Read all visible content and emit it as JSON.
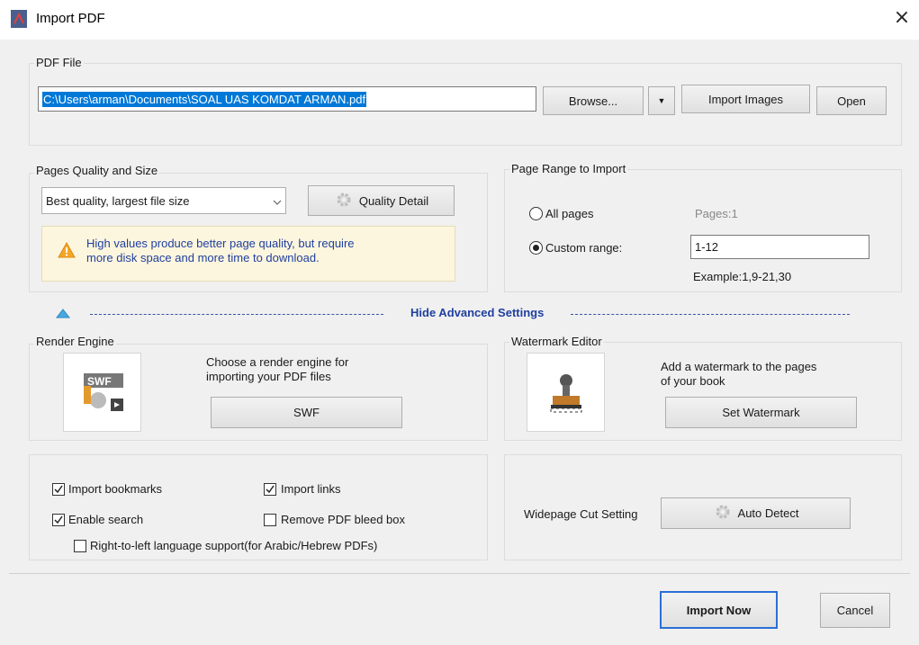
{
  "window": {
    "title": "Import PDF",
    "close_glyph": "×"
  },
  "pdf_file": {
    "group_label": "PDF File",
    "path_value": "C:\\Users\\arman\\Documents\\SOAL UAS KOMDAT ARMAN.pdf",
    "browse_label": "Browse...",
    "dropdown_glyph": "▼",
    "import_images_label": "Import Images",
    "open_label": "Open"
  },
  "quality": {
    "group_label": "Pages Quality and Size",
    "selected": "Best quality, largest file size",
    "quality_detail_label": "Quality Detail",
    "warning_text_line1": "High values produce better page quality, but require",
    "warning_text_line2": "more disk space and more time to download."
  },
  "page_range": {
    "group_label": "Page Range to Import",
    "all_pages_label": "All pages",
    "pages_info": "Pages:1",
    "custom_range_label": "Custom range:",
    "custom_range_value": "1-12",
    "example": "Example:1,9-21,30",
    "selected": "custom"
  },
  "advanced": {
    "toggle_label": "Hide Advanced Settings"
  },
  "render_engine": {
    "group_label": "Render Engine",
    "description_line1": "Choose a render engine for",
    "description_line2": "importing your PDF files",
    "button_label": "SWF",
    "icon_text": "SWF"
  },
  "watermark": {
    "group_label": "Watermark Editor",
    "description_line1": "Add a watermark to the pages",
    "description_line2": "of your book",
    "button_label": "Set Watermark"
  },
  "options": {
    "import_bookmarks": {
      "label": "Import bookmarks",
      "checked": true
    },
    "import_links": {
      "label": "Import links",
      "checked": true
    },
    "enable_search": {
      "label": "Enable search",
      "checked": true
    },
    "remove_bleed": {
      "label": "Remove PDF bleed box",
      "checked": false
    },
    "rtl_support": {
      "label": "Right-to-left language support(for Arabic/Hebrew PDFs)",
      "checked": false
    }
  },
  "widepage": {
    "label": "Widepage Cut Setting",
    "button_label": "Auto Detect"
  },
  "footer": {
    "import_now_label": "Import Now",
    "cancel_label": "Cancel"
  },
  "colors": {
    "accent": "#2a6fd6",
    "selection": "#0078d7",
    "link_blue": "#1f3f9f"
  }
}
